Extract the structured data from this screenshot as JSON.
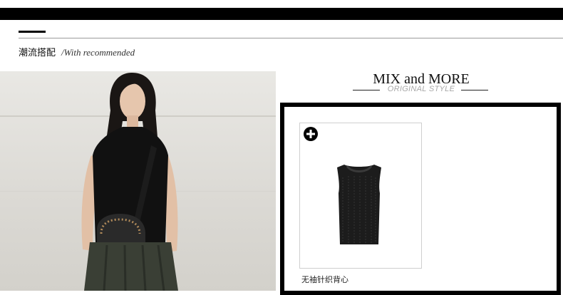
{
  "section": {
    "title_cn": "潮流搭配",
    "title_en": "/With recommended"
  },
  "mix": {
    "title": "MIX and MORE",
    "subtitle": "ORIGINAL STYLE"
  },
  "product": {
    "name": "无袖针织背心",
    "add_icon": "plus-circle-icon"
  },
  "photo": {
    "subject": "model-photo"
  }
}
